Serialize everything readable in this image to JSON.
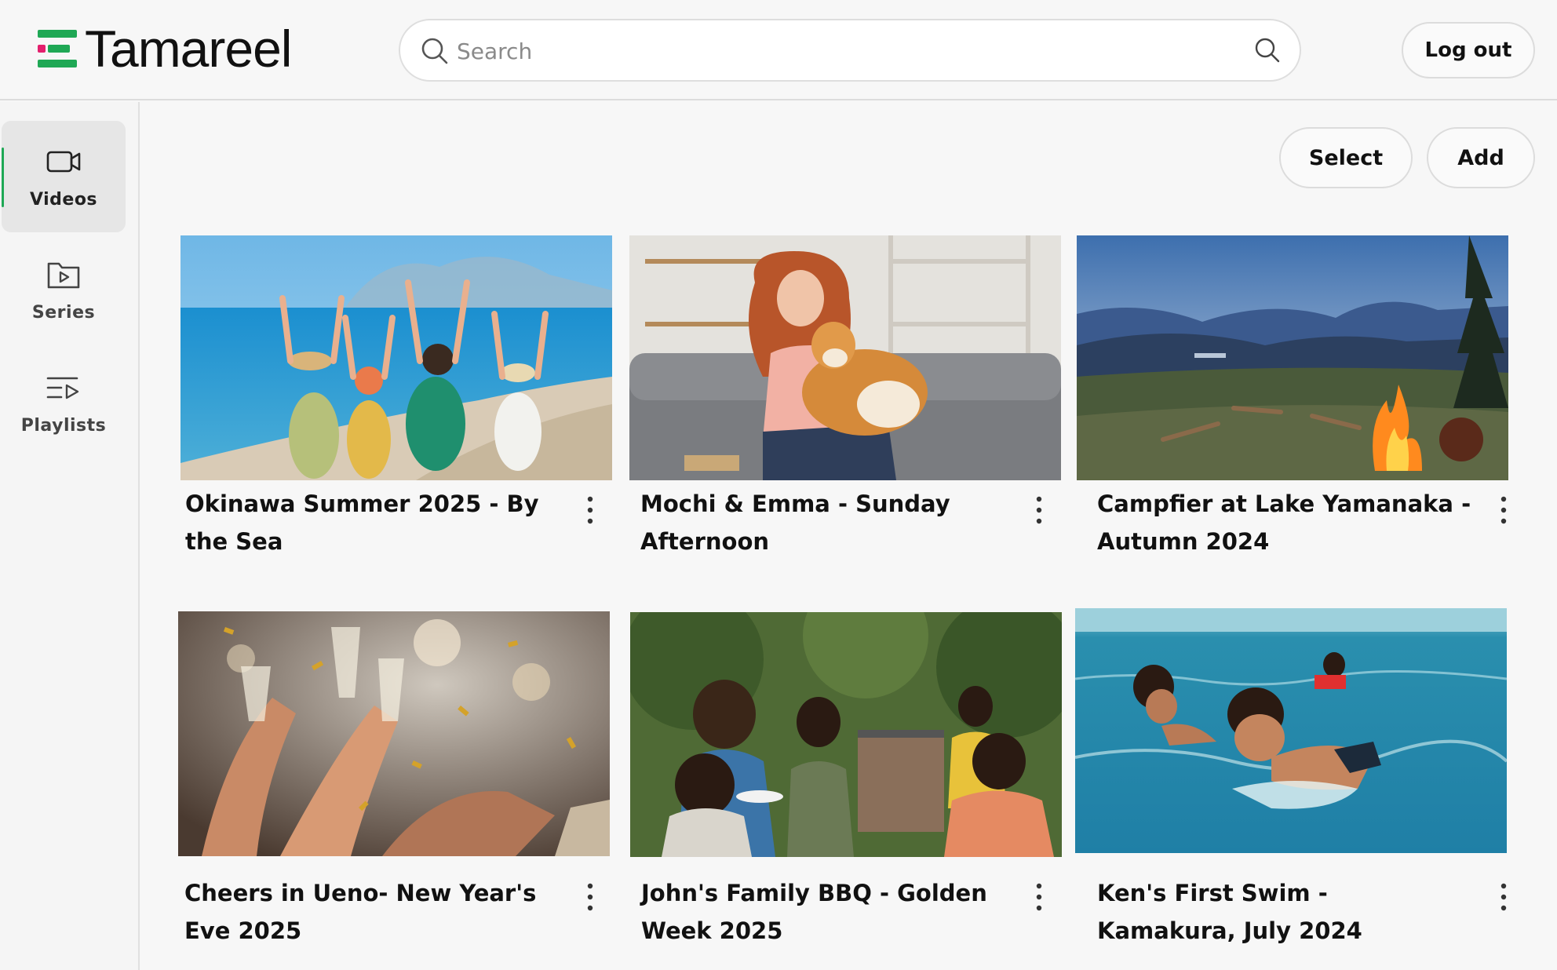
{
  "app": {
    "name": "Tamareel",
    "brand_green": "#1fa855",
    "brand_pink": "#e3206d"
  },
  "header": {
    "search_placeholder": "Search",
    "logout_label": "Log out"
  },
  "sidebar": {
    "items": [
      {
        "label": "Videos",
        "icon": "video-camera-icon",
        "active": true
      },
      {
        "label": "Series",
        "icon": "folder-play-icon",
        "active": false
      },
      {
        "label": "Playlists",
        "icon": "playlist-icon",
        "active": false
      }
    ]
  },
  "toolbar": {
    "select_label": "Select",
    "add_label": "Add"
  },
  "videos": [
    {
      "title": "Okinawa Summer 2025 - By the Sea",
      "thumbnail": "beach-family-thumbnail"
    },
    {
      "title": "Mochi & Emma - Sunday Afternoon",
      "thumbnail": "woman-with-dog-thumbnail"
    },
    {
      "title": "Campfier at Lake Yamanaka - Autumn 2024",
      "thumbnail": "campfire-mountains-thumbnail"
    },
    {
      "title": "Cheers in Ueno- New Year's Eve 2025",
      "thumbnail": "party-toast-thumbnail"
    },
    {
      "title": "John's Family BBQ - Golden Week 2025",
      "thumbnail": "family-bbq-thumbnail"
    },
    {
      "title": "Ken's First Swim - Kamakura, July 2024",
      "thumbnail": "kids-swimming-thumbnail"
    }
  ]
}
